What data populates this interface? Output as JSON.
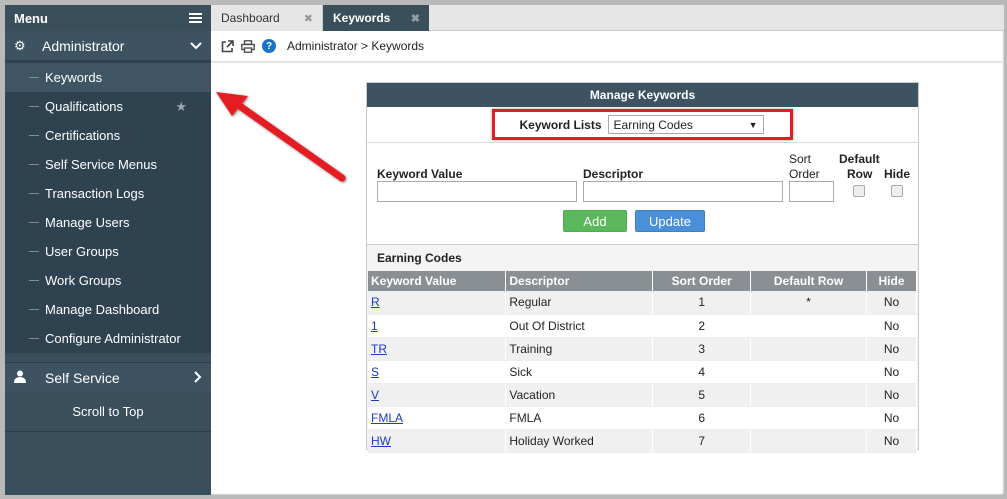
{
  "sidebar": {
    "menu_label": "Menu",
    "hamburger_icon": "hamburger-icon",
    "admin": {
      "label": "Administrator",
      "icon": "gear-icon",
      "chevron": "chevron-down-icon"
    },
    "items": [
      {
        "label": "Keywords"
      },
      {
        "label": "Qualifications",
        "star": "★"
      },
      {
        "label": "Certifications"
      },
      {
        "label": "Self Service Menus"
      },
      {
        "label": "Transaction Logs"
      },
      {
        "label": "Manage Users"
      },
      {
        "label": "User Groups"
      },
      {
        "label": "Work Groups"
      },
      {
        "label": "Manage Dashboard"
      },
      {
        "label": "Configure Administrator"
      }
    ],
    "self_service": {
      "label": "Self Service",
      "icon": "user-icon",
      "chevron": "chevron-right-icon"
    },
    "scroll_top": "Scroll to Top"
  },
  "tabs": [
    {
      "label": "Dashboard",
      "close": "✖"
    },
    {
      "label": "Keywords",
      "close": "✖"
    }
  ],
  "breadcrumb": {
    "text": "Administrator > Keywords",
    "help": "?"
  },
  "panel": {
    "title": "Manage Keywords",
    "keyword_lists_label": "Keyword Lists",
    "keyword_lists_value": "Earning Codes",
    "select_arrow": "▼",
    "form": {
      "keyword_value_label": "Keyword Value",
      "descriptor_label": "Descriptor",
      "sort_order_label_1": "Sort",
      "sort_order_label_2": "Order",
      "default_row_label_1": "Default",
      "default_row_label_2": "Row",
      "hide_label": "Hide",
      "add_label": "Add",
      "update_label": "Update"
    },
    "table": {
      "title": "Earning Codes",
      "headers": [
        "Keyword Value",
        "Descriptor",
        "Sort Order",
        "Default Row",
        "Hide"
      ],
      "rows": [
        {
          "keyword": "R",
          "descriptor": "Regular",
          "sort": "1",
          "default": "*",
          "hide": "No"
        },
        {
          "keyword": "1",
          "descriptor": "Out Of District",
          "sort": "2",
          "default": "",
          "hide": "No"
        },
        {
          "keyword": "TR",
          "descriptor": "Training",
          "sort": "3",
          "default": "",
          "hide": "No"
        },
        {
          "keyword": "S",
          "descriptor": "Sick",
          "sort": "4",
          "default": "",
          "hide": "No"
        },
        {
          "keyword": "V",
          "descriptor": "Vacation",
          "sort": "5",
          "default": "",
          "hide": "No"
        },
        {
          "keyword": "FMLA",
          "descriptor": "FMLA",
          "sort": "6",
          "default": "",
          "hide": "No"
        },
        {
          "keyword": "HW",
          "descriptor": "Holiday Worked",
          "sort": "7",
          "default": "",
          "hide": "No"
        }
      ]
    }
  },
  "colors": {
    "sidebar": "#3a4f5c",
    "highlight": "#e51c23",
    "add": "#5cb85c",
    "update": "#4a90d9"
  }
}
